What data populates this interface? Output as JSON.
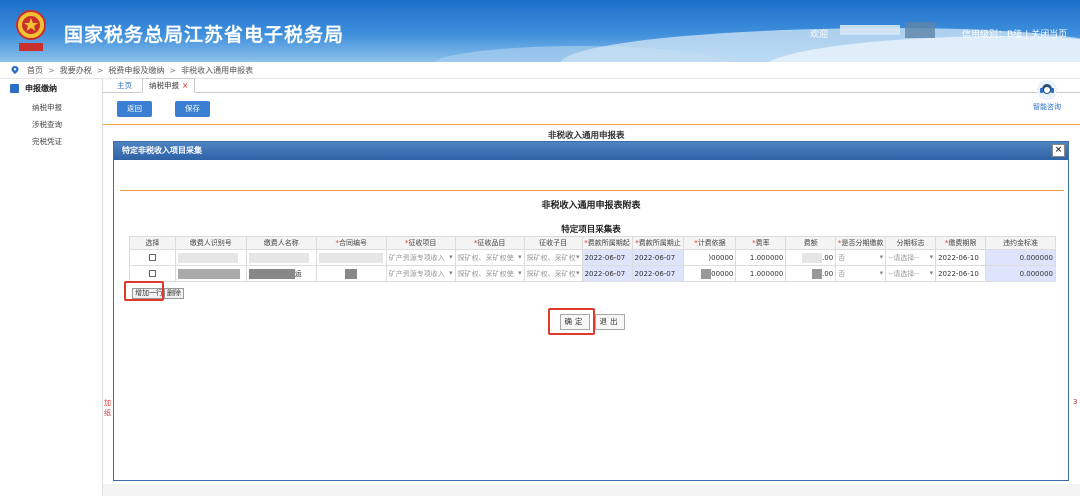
{
  "header": {
    "title": "国家税务总局江苏省电子税务局",
    "welcome": "欢迎",
    "credit": "信用级别：B级",
    "close_page": "关闭当页"
  },
  "breadcrumb": [
    "首页",
    "我要办税",
    "税费申报及缴纳",
    "非税收入通用申报表"
  ],
  "sidebar": {
    "head": "申报缴纳",
    "items": [
      "纳税申报",
      "涉税查询",
      "完税凭证"
    ]
  },
  "tabs": [
    {
      "label": "主页"
    },
    {
      "label": "纳税申报",
      "close": "×"
    }
  ],
  "toolbar": {
    "back": "返回",
    "save": "保存"
  },
  "help": {
    "label": "智能咨询"
  },
  "page_heading": "非税收入通用申报表",
  "side_chars": {
    "left": "加\n纸",
    "right": "3"
  },
  "modal": {
    "title": "特定非税收入项目采集",
    "close": "×",
    "sub1": "非税收入通用申报表附表",
    "sub2": "特定项目采集表",
    "columns": [
      {
        "label": "选择",
        "req": false
      },
      {
        "label": "缴费人识别号",
        "req": false
      },
      {
        "label": "缴费人名称",
        "req": false
      },
      {
        "label": "合同编号",
        "req": true
      },
      {
        "label": "征收项目",
        "req": true
      },
      {
        "label": "征收品目",
        "req": true
      },
      {
        "label": "征收子目",
        "req": false
      },
      {
        "label": "费款所属期起",
        "req": true
      },
      {
        "label": "费款所属期止",
        "req": true
      },
      {
        "label": "计费依据",
        "req": true
      },
      {
        "label": "费率",
        "req": true
      },
      {
        "label": "费额",
        "req": false
      },
      {
        "label": "是否分期缴款",
        "req": true
      },
      {
        "label": "分期标志",
        "req": false
      },
      {
        "label": "缴费期限",
        "req": true
      },
      {
        "label": "违约金标准",
        "req": false
      }
    ],
    "rows": [
      {
        "name_tail": "",
        "project": "矿产资源专项收入",
        "item": "探矿权、采矿权使",
        "subitem": "探矿权、采矿权",
        "start": "2022-06-07",
        "end": "2022-06-07",
        "basis": ")00000",
        "rate": "1.000000",
        "amount_tail": ".00",
        "installment": "否",
        "flag": "--请选择--",
        "deadline": "2022-06-10",
        "penalty": "0.000000"
      },
      {
        "name_tail": "运",
        "project": "矿产资源专项收入",
        "item": "探矿权、采矿权使",
        "subitem": "探矿权、采矿权",
        "start": "2022-06-07",
        "end": "2022-06-07",
        "basis": "00000",
        "rate": "1.000000",
        "amount_tail": ".00",
        "installment": "否",
        "flag": "--请选择--",
        "deadline": "2022-06-10",
        "penalty": "0.000000"
      }
    ],
    "add_row": "增加一行",
    "delete_row": "删除",
    "confirm": "确定",
    "exit": "退出"
  },
  "colors": {
    "brand": "#1c6fc8",
    "accent": "#3a7fd1",
    "highlight": "#e0392c",
    "divider": "#f0a040"
  }
}
